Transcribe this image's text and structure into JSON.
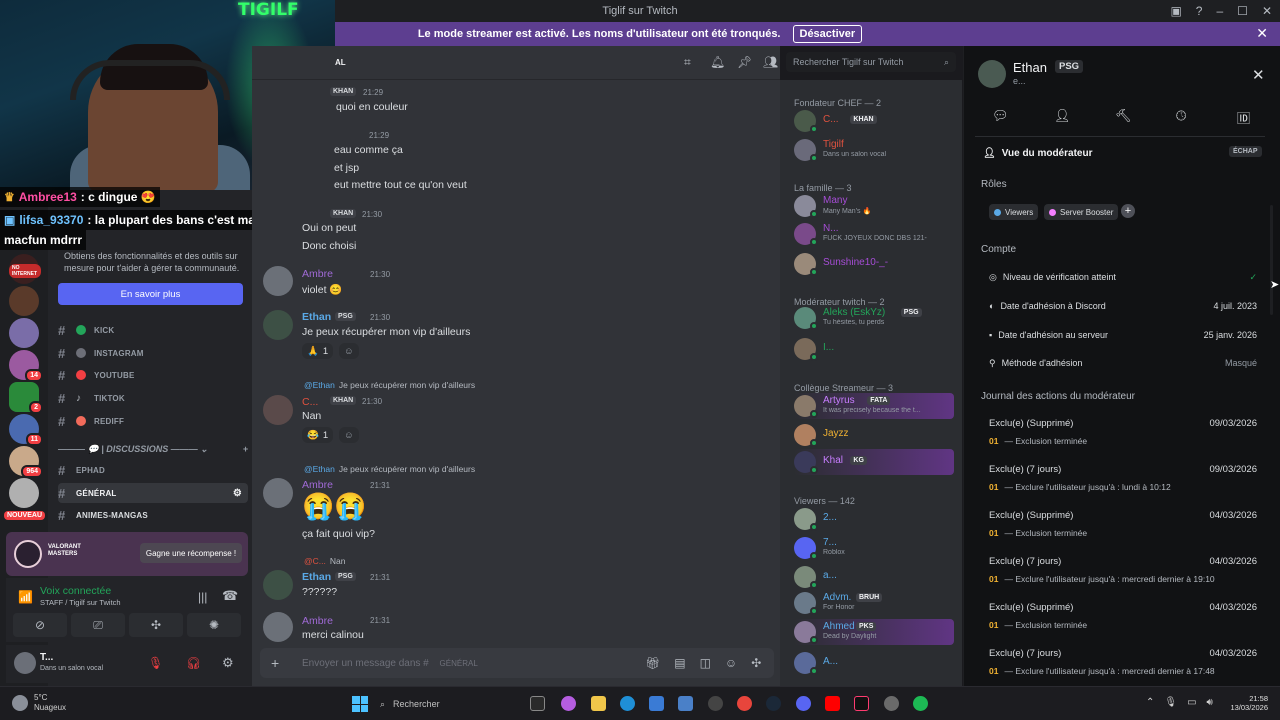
{
  "window": {
    "title": "Tiglif sur Twitch",
    "controls": [
      "▣",
      "?",
      "–",
      "☐",
      "✕"
    ]
  },
  "banner": {
    "text": "Le mode streamer est activé. Les noms d'utilisateur ont été tronqués.",
    "button": "Désactiver"
  },
  "webcam": {
    "neon_sign": "TIGILF"
  },
  "overlay_chat": [
    {
      "user": "Ambree13",
      "text": ": c dingue 😍",
      "user_color": "#ff4fa3"
    },
    {
      "user": "lifsa_93370",
      "text": ": la plupart des bans c'est many ou",
      "user_color": "#6fc3ff"
    },
    {
      "user": "",
      "text": "macfun mdrrr",
      "user_color": "#ffffff"
    }
  ],
  "server_badges": [
    "NO INTERNET",
    "14",
    "2",
    "11",
    "964",
    "NOUVEAU"
  ],
  "sidebar": {
    "promo_text": "Obtiens des fonctionnalités et des outils sur mesure pour t'aider à gérer ta communauté.",
    "promo_button": "En savoir plus",
    "channels": [
      {
        "name": "KICK",
        "color": "#23a55a"
      },
      {
        "name": "INSTAGRAM",
        "color": "#6d6f78"
      },
      {
        "name": "YOUTUBE",
        "color": "#f23f43"
      },
      {
        "name": "TIKTOK",
        "color": "#6d6f78"
      },
      {
        "name": "REDIFF",
        "color": "#f26b5b"
      }
    ],
    "category": "DISCUSSIONS",
    "channels2": [
      {
        "name": "EPHAD"
      },
      {
        "name": "GÉNÉRAL"
      },
      {
        "name": "ANIMES-MANGAS"
      }
    ],
    "quest_title": "VALORANT MASTERS",
    "quest_button": "Gagne une récompense !",
    "voice_title": "Voix connectée",
    "voice_sub": "STAFF / Tigilf sur Twitch",
    "user_name": "T...",
    "user_status": "Dans un salon vocal"
  },
  "chat": {
    "header": "AL",
    "search_placeholder": "Rechercher Tigilf sur Twitch",
    "composer_placeholder": "Envoyer un message dans #",
    "composer_channel": "GÉNÉRAL",
    "messages": [
      {
        "name": "",
        "tag": "KHAN",
        "time": "21:29",
        "lines": [
          "quoi en couleur"
        ]
      },
      {
        "name": "",
        "tag": "",
        "time": "21:29",
        "lines": [
          "eau comme ça",
          "et jsp",
          "eut mettre tout ce qu'on veut"
        ]
      },
      {
        "name": "",
        "tag": "KHAN",
        "time": "21:30",
        "lines": [
          "Oui on peut",
          "Donc choisi"
        ]
      },
      {
        "name": "Ambre",
        "tag": "",
        "time": "21:30",
        "lines": [
          "violet 😊"
        ]
      },
      {
        "name": "Ethan",
        "tag": "PSG",
        "time": "21:30",
        "lines": [
          "Je peux récupérer mon vip d'ailleurs"
        ],
        "reaction": "1"
      },
      {
        "reply_name": "@Ethan",
        "reply_text": "Je peux récupérer mon vip d'ailleurs",
        "name": "C...",
        "tag": "KHAN",
        "time": "21:30",
        "lines": [
          "Nan"
        ],
        "reaction": "1"
      },
      {
        "reply_name": "@Ethan",
        "reply_text": "Je peux récupérer mon vip d'ailleurs",
        "name": "Ambre",
        "tag": "",
        "time": "21:31",
        "lines": [
          "😭😭",
          "ça fait quoi vip?"
        ]
      },
      {
        "reply_name": "@C...",
        "reply_text": "Nan",
        "name": "Ethan",
        "tag": "PSG",
        "time": "21:31",
        "lines": [
          "??????"
        ]
      },
      {
        "name": "Ambre",
        "tag": "",
        "time": "21:31",
        "lines": [
          "merci calinou"
        ]
      }
    ]
  },
  "members": {
    "groups": [
      {
        "title": "Fondateur CHEF — 2",
        "items": [
          {
            "name": "C...",
            "color": "#e0523f",
            "tag": "KHAN",
            "desc": ""
          },
          {
            "name": "Tigilf",
            "color": "#e0523f",
            "tag": "",
            "desc": "Dans un salon vocal"
          }
        ]
      },
      {
        "title": "La famille — 3",
        "items": [
          {
            "name": "Many",
            "color": "#a64dd6",
            "tag": "",
            "desc": "Many Man's 🔥"
          },
          {
            "name": "N...",
            "color": "#a64dd6",
            "tag": "",
            "desc": "FUCK JOYEUX DONC DBS 121-"
          },
          {
            "name": "Sunshine10-_-",
            "color": "#a64dd6",
            "tag": "",
            "desc": ""
          }
        ]
      },
      {
        "title": "Modérateur twitch — 2",
        "items": [
          {
            "name": "Aleks (EskYz)",
            "color": "#23a55a",
            "tag": "PSG",
            "desc": "Tu hésites, tu perds"
          },
          {
            "name": "I...",
            "color": "#23a55a",
            "tag": "",
            "desc": ""
          }
        ]
      },
      {
        "title": "Collègue Streameur — 3",
        "items": [
          {
            "name": "Artyrus",
            "color": "#c77dff",
            "tag": "FATA",
            "desc": "It was precisely because the t..."
          },
          {
            "name": "Jayzz",
            "color": "#f0b132",
            "tag": "",
            "desc": ""
          },
          {
            "name": "Khal",
            "color": "#c77dff",
            "tag": "KG",
            "desc": ""
          }
        ]
      },
      {
        "title": "Viewers — 142",
        "items": [
          {
            "name": "2...",
            "color": "#5aa9e6",
            "tag": "",
            "desc": ""
          },
          {
            "name": "7...",
            "color": "#5aa9e6",
            "tag": "",
            "desc": "Roblox"
          },
          {
            "name": "a...",
            "color": "#5aa9e6",
            "tag": "",
            "desc": ""
          },
          {
            "name": "Advm.",
            "color": "#5aa9e6",
            "tag": "BRUH",
            "desc": "For Honor"
          },
          {
            "name": "Ahmed",
            "color": "#5aa9e6",
            "tag": "PKS",
            "desc": "Dead by Daylight"
          },
          {
            "name": "A...",
            "color": "#5aa9e6",
            "tag": "",
            "desc": ""
          }
        ]
      }
    ]
  },
  "moderator": {
    "name": "Ethan",
    "tag": "PSG",
    "sub": "e...",
    "view_title": "Vue du modérateur",
    "echap": "ÉCHAP",
    "roles_title": "Rôles",
    "roles": [
      {
        "name": "Viewers",
        "color": "#5aa9e6"
      },
      {
        "name": "Server Booster",
        "color": "#f47fff"
      }
    ],
    "account_title": "Compte",
    "account": [
      {
        "label": "Niveau de vérification atteint",
        "value": "✓"
      },
      {
        "label": "Date d'adhésion à Discord",
        "value": "4 juil. 2023"
      },
      {
        "label": "Date d'adhésion au serveur",
        "value": "25 janv. 2026"
      },
      {
        "label": "Méthode d'adhésion",
        "value": "Masqué"
      }
    ],
    "log_title": "Journal des actions du modérateur",
    "log": [
      {
        "title": "Exclu(e) (Supprimé)",
        "date": "09/03/2026",
        "num": "01",
        "text": "— Exclusion terminée"
      },
      {
        "title": "Exclu(e) (7 jours)",
        "date": "09/03/2026",
        "num": "01",
        "text": "— Exclure l'utilisateur jusqu'à : lundi à 10:12"
      },
      {
        "title": "Exclu(e) (Supprimé)",
        "date": "04/03/2026",
        "num": "01",
        "text": "— Exclusion terminée"
      },
      {
        "title": "Exclu(e) (7 jours)",
        "date": "04/03/2026",
        "num": "01",
        "text": "— Exclure l'utilisateur jusqu'à : mercredi dernier à 19:10"
      },
      {
        "title": "Exclu(e) (Supprimé)",
        "date": "04/03/2026",
        "num": "01",
        "text": "— Exclusion terminée"
      },
      {
        "title": "Exclu(e) (7 jours)",
        "date": "04/03/2026",
        "num": "01",
        "text": "— Exclure l'utilisateur jusqu'à : mercredi dernier à 17:48"
      }
    ]
  },
  "taskbar": {
    "weather_temp": "5°C",
    "weather_desc": "Nuageux",
    "search": "Rechercher",
    "time": "21:58",
    "date": "13/03/2026"
  }
}
